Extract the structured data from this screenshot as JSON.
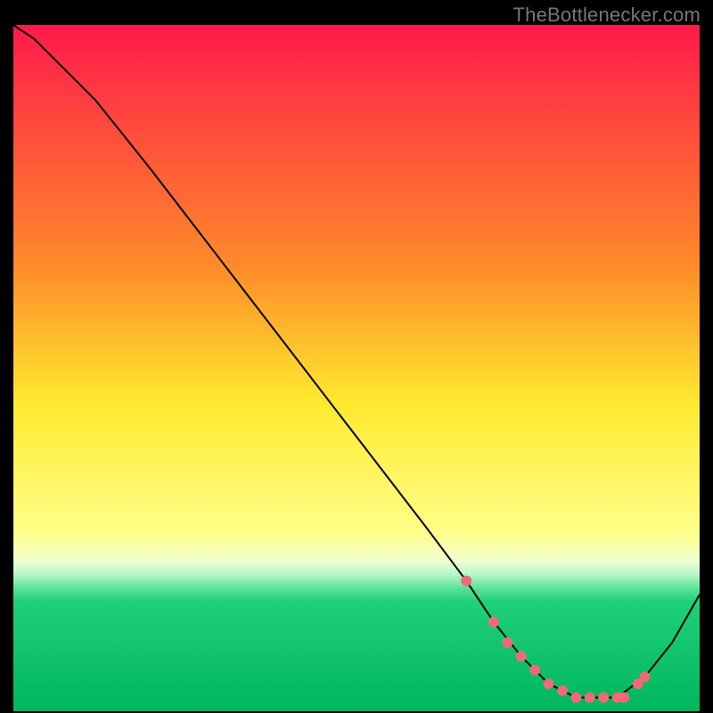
{
  "watermark": "TheBottlenecker.com",
  "chart_data": {
    "type": "line",
    "title": "",
    "xlabel": "",
    "ylabel": "",
    "xlim": [
      0,
      100
    ],
    "ylim": [
      0,
      100
    ],
    "gradient_stops": [
      {
        "offset": 0,
        "color": "#ff1a4b"
      },
      {
        "offset": 35,
        "color": "#ff8a2a"
      },
      {
        "offset": 55,
        "color": "#ffe92e"
      },
      {
        "offset": 74,
        "color": "#ffff8a"
      },
      {
        "offset": 78,
        "color": "#f2ffd0"
      },
      {
        "offset": 80,
        "color": "#baf7c8"
      },
      {
        "offset": 82,
        "color": "#5fe39a"
      },
      {
        "offset": 84,
        "color": "#1fd07a"
      },
      {
        "offset": 100,
        "color": "#00b65c"
      }
    ],
    "series": [
      {
        "name": "curve",
        "x": [
          0,
          3,
          6,
          9,
          12,
          20,
          30,
          40,
          50,
          60,
          66,
          70,
          74,
          78,
          82,
          86,
          88,
          92,
          96,
          100
        ],
        "y": [
          100,
          98,
          95,
          92,
          89,
          79,
          66,
          53,
          40,
          27,
          19,
          13,
          8,
          4,
          2,
          2,
          2,
          5,
          10,
          17
        ]
      }
    ],
    "markers": {
      "name": "highlight-dots",
      "color": "#ef6a77",
      "x": [
        66,
        70,
        72,
        74,
        76,
        78,
        80,
        82,
        84,
        86,
        88,
        89,
        91,
        92
      ],
      "y": [
        19,
        13,
        10,
        8,
        6,
        4,
        3,
        2,
        2,
        2,
        2,
        2,
        4,
        5
      ]
    }
  }
}
